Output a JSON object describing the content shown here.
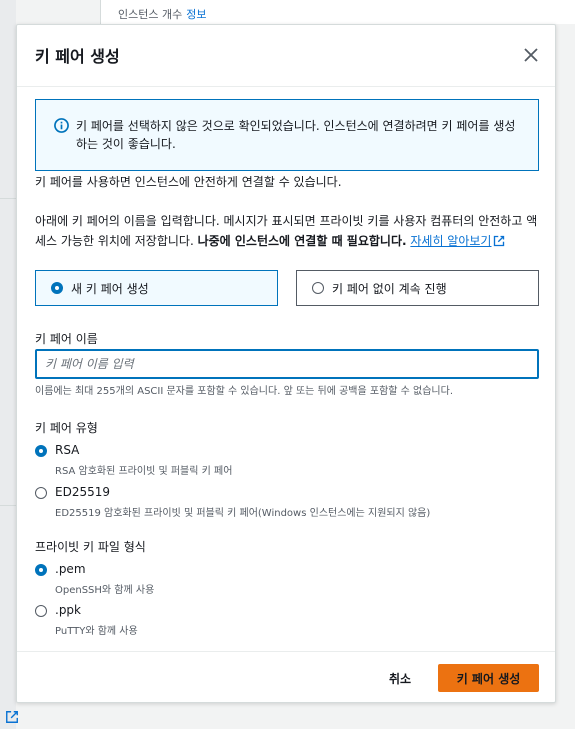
{
  "background": {
    "top_text": "인스턴스 개수",
    "top_link": "정보"
  },
  "modal": {
    "title": "키 페어 생성",
    "alert": {
      "text": "키 페어를 선택하지 않은 것으로 확인되었습니다. 인스턴스에 연결하려면 키 페어를 생성하는 것이 좋습니다."
    },
    "intro": "키 페어를 사용하면 인스턴스에 안전하게 연결할 수 있습니다.",
    "description": {
      "text": "아래에 키 페어의 이름을 입력합니다. 메시지가 표시되면 프라이빗 키를 사용자 컴퓨터의 안전하고 액세스 가능한 위치에 저장합니다. ",
      "bold": "나중에 인스턴스에 연결할 때 필요합니다.",
      "link": "자세히 알아보기"
    },
    "tiles": {
      "new_label": "새 키 페어 생성",
      "none_label": "키 페어 없이 계속 진행",
      "selected": "new"
    },
    "name_field": {
      "label": "키 페어 이름",
      "placeholder": "키 페어 이름 입력",
      "value": "",
      "hint": "이름에는 최대 255개의 ASCII 문자를 포함할 수 있습니다. 앞 또는 뒤에 공백을 포함할 수 없습니다."
    },
    "key_type": {
      "label": "키 페어 유형",
      "options": [
        {
          "title": "RSA",
          "desc": "RSA 암호화된 프라이빗 및 퍼블릭 키 페어",
          "checked": true
        },
        {
          "title": "ED25519",
          "desc": "ED25519 암호화된 프라이빗 및 퍼블릭 키 페어(Windows 인스턴스에는 지원되지 않음)",
          "checked": false
        }
      ]
    },
    "file_format": {
      "label": "프라이빗 키 파일 형식",
      "options": [
        {
          "title": ".pem",
          "desc": "OpenSSH와 함께 사용",
          "checked": true
        },
        {
          "title": ".ppk",
          "desc": "PuTTY와 함께 사용",
          "checked": false
        }
      ]
    },
    "footer": {
      "cancel_label": "취소",
      "create_label": "키 페어 생성"
    }
  },
  "colors": {
    "accent": "#0073bb",
    "primary_button": "#ec7211",
    "alert_bg": "#f1faff"
  }
}
